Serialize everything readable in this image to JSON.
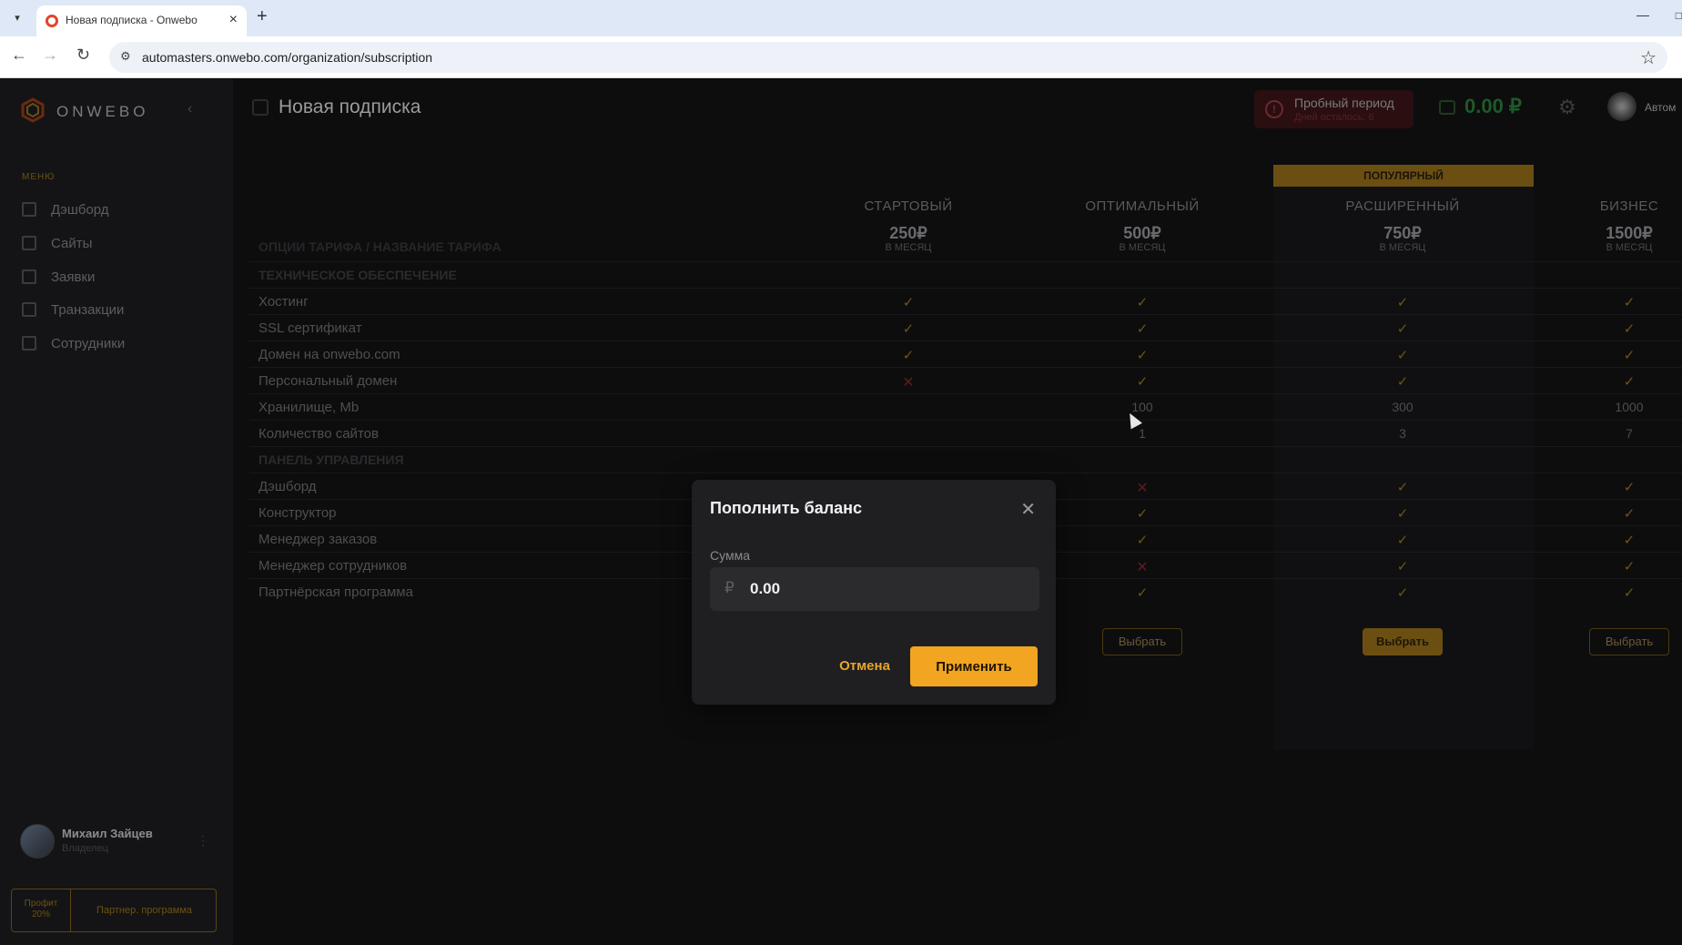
{
  "browser": {
    "tab_title": "Новая подписка - Onwebo",
    "url": "automasters.onwebo.com/organization/subscription"
  },
  "sidebar": {
    "logo_text": "ONWEBO",
    "menu_caption": "МЕНЮ",
    "items": [
      {
        "label": "Дэшборд",
        "icon": "dashboard-icon"
      },
      {
        "label": "Сайты",
        "icon": "sites-icon"
      },
      {
        "label": "Заявки",
        "icon": "requests-icon"
      },
      {
        "label": "Транзакции",
        "icon": "transactions-icon"
      },
      {
        "label": "Сотрудники",
        "icon": "employees-icon"
      }
    ],
    "user": {
      "name": "Михаил Зайцев",
      "role": "Владелец"
    },
    "partner": {
      "profit_label": "Профит",
      "profit_value": "20%",
      "program_label": "Партнер. программа"
    }
  },
  "header": {
    "title": "Новая подписка",
    "trial_title": "Пробный период",
    "trial_sub": "Дней осталось: 6",
    "balance": "0.00 ₽",
    "user_short": "Автом"
  },
  "plans": {
    "options_header": "ОПЦИИ ТАРИФА / НАЗВАНИЕ ТАРИФА",
    "popular_badge": "ПОПУЛЯРНЫЙ",
    "per_month": "В МЕСЯЦ",
    "choose_label": "Выбрать",
    "columns": [
      {
        "name": "СТАРТОВЫЙ",
        "price": "250₽"
      },
      {
        "name": "ОПТИМАЛЬНЫЙ",
        "price": "500₽"
      },
      {
        "name": "РАСШИРЕННЫЙ",
        "price": "750₽"
      },
      {
        "name": "БИЗНЕС",
        "price": "1500₽"
      }
    ],
    "rows": [
      {
        "type": "section",
        "label": "ТЕХНИЧЕСКОЕ ОБЕСПЕЧЕНИЕ"
      },
      {
        "type": "row",
        "label": "Хостинг",
        "cells": [
          "✓",
          "✓",
          "✓",
          "✓"
        ]
      },
      {
        "type": "row",
        "label": "SSL сертификат",
        "cells": [
          "✓",
          "✓",
          "✓",
          "✓"
        ]
      },
      {
        "type": "row",
        "label": "Домен на onwebo.com",
        "cells": [
          "✓",
          "✓",
          "✓",
          "✓"
        ]
      },
      {
        "type": "row",
        "label": "Персональный домен",
        "cells": [
          "✕",
          "✓",
          "✓",
          "✓"
        ]
      },
      {
        "type": "row",
        "label": "Хранилище, Mb",
        "cells": [
          "",
          "100",
          "300",
          "1000"
        ]
      },
      {
        "type": "row",
        "label": "Количество сайтов",
        "cells": [
          "",
          "1",
          "3",
          "7"
        ]
      },
      {
        "type": "section",
        "label": "ПАНЕЛЬ УПРАВЛЕНИЯ"
      },
      {
        "type": "row",
        "label": "Дэшборд",
        "cells": [
          "",
          "✕",
          "✓",
          "✓"
        ]
      },
      {
        "type": "row",
        "label": "Конструктор",
        "cells": [
          "",
          "✓",
          "✓",
          "✓"
        ]
      },
      {
        "type": "row",
        "label": "Менеджер заказов",
        "cells": [
          "",
          "✓",
          "✓",
          "✓"
        ]
      },
      {
        "type": "row",
        "label": "Менеджер сотрудников",
        "cells": [
          "",
          "✕",
          "✓",
          "✓"
        ]
      },
      {
        "type": "row",
        "label": "Партнёрская программа",
        "cells": [
          "",
          "✓",
          "✓",
          "✓"
        ]
      }
    ]
  },
  "modal": {
    "title": "Пополнить баланс",
    "amount_label": "Сумма",
    "currency_symbol": "₽",
    "amount_value": "0.00",
    "cancel_label": "Отмена",
    "apply_label": "Применить"
  }
}
